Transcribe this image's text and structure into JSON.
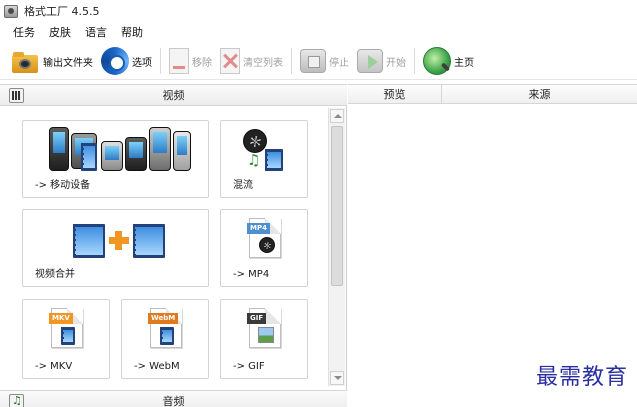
{
  "window": {
    "title": "格式工厂 4.5.5"
  },
  "menu": {
    "items": [
      "任务",
      "皮肤",
      "语言",
      "帮助"
    ]
  },
  "toolbar": {
    "output_folder": "输出文件夹",
    "options": "选项",
    "remove": "移除",
    "clear_list": "清空列表",
    "stop": "停止",
    "start": "开始",
    "home": "主页"
  },
  "categories": {
    "video": "视频",
    "audio": "音频"
  },
  "tiles": {
    "mobile": "-> 移动设备",
    "mix": "混流",
    "merge": "视频合并",
    "mp4": "-> MP4",
    "mkv": "-> MKV",
    "webm": "-> WebM",
    "gif": "-> GIF"
  },
  "doc_tags": {
    "mp4": "MP4",
    "mkv": "MKV",
    "webm": "WebM",
    "gif": "GIF"
  },
  "task_list": {
    "columns": [
      "预览",
      "来源"
    ]
  },
  "watermark": "最需教育",
  "icons": [
    "app-icon",
    "folder-camera-icon",
    "options-gear-icon",
    "remove-icon",
    "clear-list-icon",
    "stop-icon",
    "start-icon",
    "home-globe-icon",
    "film-clapper-icon",
    "music-note-icon"
  ],
  "colors": {
    "accent_orange": "#f19523",
    "film_blue": "#24427a",
    "watermark_blue": "#2a2fa0"
  }
}
